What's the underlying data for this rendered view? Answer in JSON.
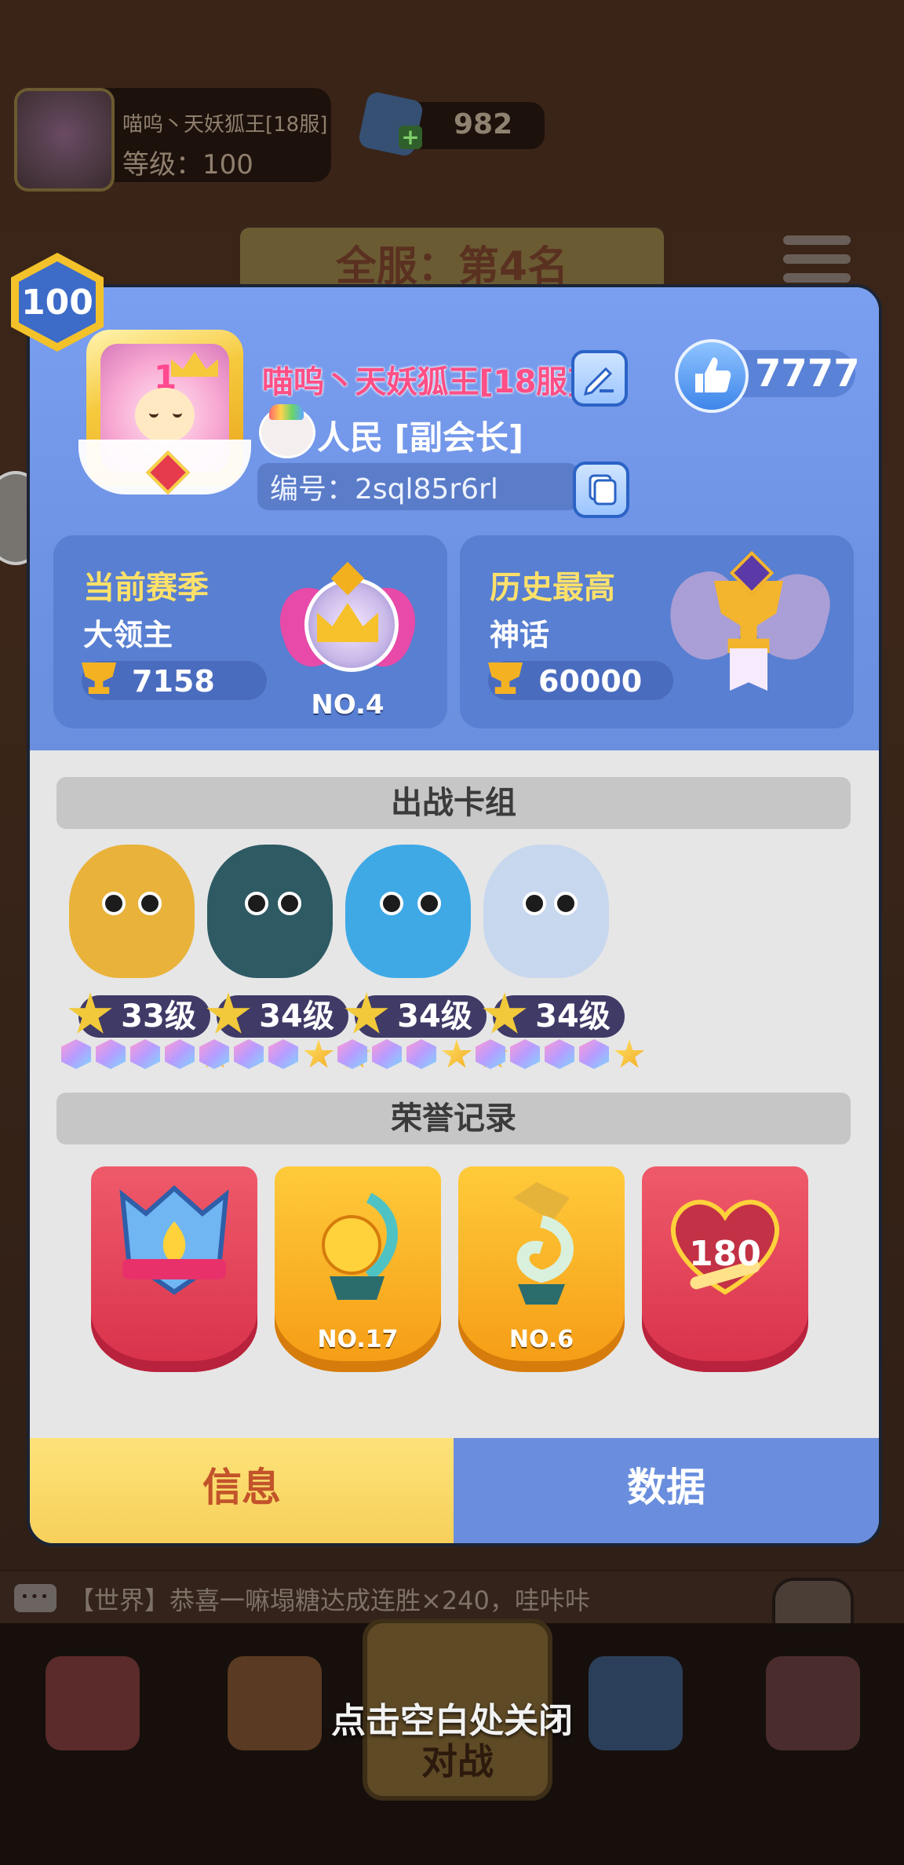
{
  "background": {
    "player_name": "喵呜丶天妖狐王[18服]",
    "player_level": "等级：100",
    "gems": "982",
    "server_rank": "全服：第4名",
    "chat_text": "【世界】恭喜一嘛塌糖达成连胜×240，哇咔咔",
    "battle_label": "对战"
  },
  "close_hint": "点击空白处关闭",
  "profile": {
    "level_badge": "100",
    "name": "喵呜丶天妖狐王[18服]",
    "likes": "7777",
    "guild": "人民 [副会长]",
    "id_label": "编号：2sql85r6rl"
  },
  "season": {
    "title": "当前赛季",
    "tier": "大领主",
    "trophies": "7158",
    "rank": "NO.4"
  },
  "history": {
    "title": "历史最高",
    "tier": "神话",
    "trophies": "60000"
  },
  "deck": {
    "title": "出战卡组",
    "heroes": [
      {
        "level": "33级",
        "color": "#e9b23a",
        "stars": 1
      },
      {
        "level": "34级",
        "color": "#2e5a64",
        "stars": 2
      },
      {
        "level": "34级",
        "color": "#3fa9e6",
        "stars": 2
      },
      {
        "level": "34级",
        "color": "#c7d7ee",
        "stars": 1
      }
    ]
  },
  "honors": {
    "title": "荣誉记录",
    "items": [
      {
        "label": "",
        "style": "red"
      },
      {
        "label": "NO.17",
        "style": "orange"
      },
      {
        "label": "NO.6",
        "style": "orange"
      },
      {
        "label": "180",
        "style": "red"
      }
    ]
  },
  "tabs": {
    "info": "信息",
    "data": "数据"
  },
  "colors": {
    "panel_blue": "#7a9ef0",
    "name_pink": "#ff4f86",
    "title_yellow": "#ffe16a",
    "info_tab": "#fde37a",
    "data_tab": "#6a8edd"
  }
}
